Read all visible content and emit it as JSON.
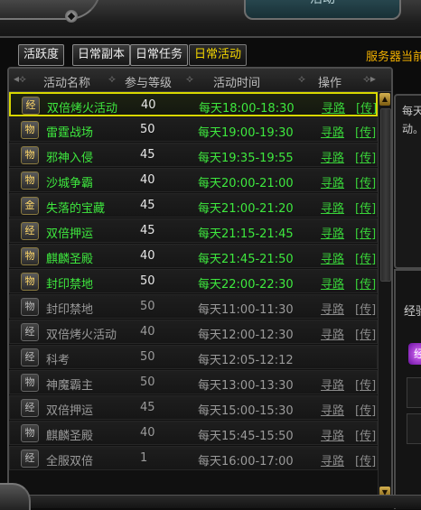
{
  "window": {
    "title": "活动"
  },
  "tabs": [
    {
      "label": "活跃度",
      "active": false
    },
    {
      "label": "日常副本",
      "active": false
    },
    {
      "label": "日常任务",
      "active": false
    },
    {
      "label": "日常活动",
      "active": true
    }
  ],
  "server_text": "服务器当前",
  "table": {
    "headers": {
      "name": "活动名称",
      "level": "参与等级",
      "time": "活动时间",
      "action": "操作"
    },
    "rows": [
      {
        "icon": "经",
        "name": "双倍烤火活动",
        "level": "40",
        "time": "每天18:00-18:30",
        "find": "寻路",
        "tele": "[传]",
        "state": "active",
        "selected": true
      },
      {
        "icon": "物",
        "name": "雷霆战场",
        "level": "50",
        "time": "每天19:00-19:30",
        "find": "寻路",
        "tele": "[传]",
        "state": "active"
      },
      {
        "icon": "物",
        "name": "邪神入侵",
        "level": "45",
        "time": "每天19:35-19:55",
        "find": "寻路",
        "tele": "[传]",
        "state": "active"
      },
      {
        "icon": "物",
        "name": "沙城争霸",
        "level": "40",
        "time": "每天20:00-21:00",
        "find": "寻路",
        "tele": "[传]",
        "state": "active"
      },
      {
        "icon": "金",
        "name": "失落的宝藏",
        "level": "45",
        "time": "每天21:00-21:20",
        "find": "寻路",
        "tele": "[传]",
        "state": "active"
      },
      {
        "icon": "经",
        "name": "双倍押运",
        "level": "45",
        "time": "每天21:15-21:45",
        "find": "寻路",
        "tele": "[传]",
        "state": "active"
      },
      {
        "icon": "物",
        "name": "麒麟圣殿",
        "level": "40",
        "time": "每天21:45-21:50",
        "find": "寻路",
        "tele": "[传]",
        "state": "active"
      },
      {
        "icon": "物",
        "name": "封印禁地",
        "level": "50",
        "time": "每天22:00-22:30",
        "find": "寻路",
        "tele": "[传]",
        "state": "active"
      },
      {
        "icon": "物",
        "name": "封印禁地",
        "level": "50",
        "time": "每天11:00-11:30",
        "find": "寻路",
        "tele": "[传]",
        "state": "inactive"
      },
      {
        "icon": "经",
        "name": "双倍烤火活动",
        "level": "40",
        "time": "每天12:00-12:30",
        "find": "寻路",
        "tele": "[传]",
        "state": "inactive"
      },
      {
        "icon": "经",
        "name": "科考",
        "level": "50",
        "time": "每天12:05-12:12",
        "find": "",
        "tele": "",
        "state": "inactive"
      },
      {
        "icon": "物",
        "name": "神魔霸主",
        "level": "50",
        "time": "每天13:00-13:30",
        "find": "寻路",
        "tele": "[传]",
        "state": "inactive"
      },
      {
        "icon": "经",
        "name": "双倍押运",
        "level": "45",
        "time": "每天15:00-15:30",
        "find": "寻路",
        "tele": "[传]",
        "state": "inactive"
      },
      {
        "icon": "物",
        "name": "麒麟圣殿",
        "level": "40",
        "time": "每天15:45-15:50",
        "find": "寻路",
        "tele": "[传]",
        "state": "inactive"
      },
      {
        "icon": "经",
        "name": "全服双倍",
        "level": "1",
        "time": "每天16:00-17:00",
        "find": "寻路",
        "tele": "[传]",
        "state": "inactive"
      }
    ]
  },
  "right_panel": {
    "line1": "每天",
    "line2": "动。",
    "lower_label": "经验",
    "orb": "经"
  },
  "colors": {
    "active_text": "#3ee83e",
    "inactive_text": "#9a9a9a",
    "tab_active": "#f2d500",
    "highlight": "#d9d800"
  }
}
